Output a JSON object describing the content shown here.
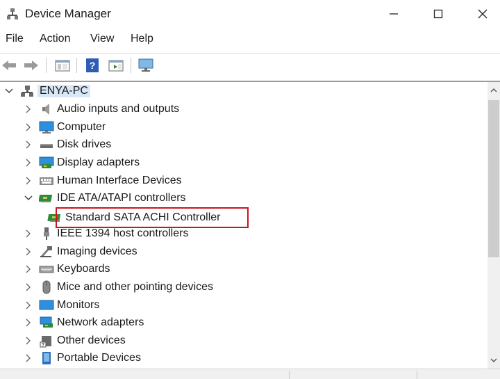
{
  "window": {
    "title": "Device Manager"
  },
  "menu": [
    "File",
    "Action",
    "View",
    "Help"
  ],
  "colors": {
    "accent": "#d0121b",
    "selection": "#d9e8f7",
    "monitor": "#2f8fdf",
    "board": "#2c8a3c"
  },
  "tree": {
    "root": {
      "label": "ENYA-PC",
      "icon": "computer-tree-icon"
    },
    "items": [
      {
        "label": "Audio inputs and outputs",
        "icon": "speaker-icon",
        "expanded": false
      },
      {
        "label": "Computer",
        "icon": "monitor-icon",
        "expanded": false
      },
      {
        "label": "Disk drives",
        "icon": "disk-drive-icon",
        "expanded": false
      },
      {
        "label": "Display adapters",
        "icon": "display-adapter-icon",
        "expanded": false
      },
      {
        "label": "Human Interface Devices",
        "icon": "hid-icon",
        "expanded": false
      },
      {
        "label": "IDE ATA/ATAPI controllers",
        "icon": "ide-controller-icon",
        "expanded": true
      },
      {
        "label": "Standard SATA ACHI Controller",
        "icon": "controller-card-icon",
        "child": true
      },
      {
        "label": "IEEE 1394 host controllers",
        "icon": "plug-icon",
        "expanded": false
      },
      {
        "label": "Imaging devices",
        "icon": "camera-icon",
        "expanded": false
      },
      {
        "label": "Keyboards",
        "icon": "keyboard-icon",
        "expanded": false
      },
      {
        "label": "Mice and other pointing devices",
        "icon": "mouse-icon",
        "expanded": false
      },
      {
        "label": "Monitors",
        "icon": "monitor-icon",
        "expanded": false
      },
      {
        "label": "Network adapters",
        "icon": "network-icon",
        "expanded": false
      },
      {
        "label": "Other devices",
        "icon": "unknown-device-icon",
        "expanded": false
      },
      {
        "label": "Portable Devices",
        "icon": "portable-device-icon",
        "expanded": false
      }
    ]
  }
}
